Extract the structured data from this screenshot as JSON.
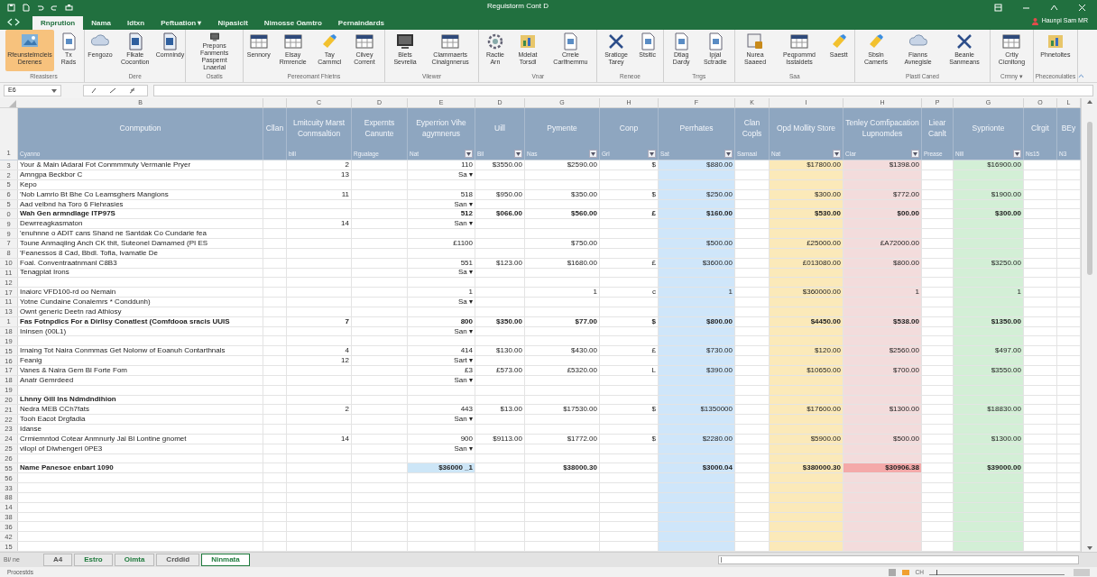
{
  "window": {
    "title": "Reguistorm Cont D",
    "account": "Haunpi Sam MR"
  },
  "ribbon_tabs": [
    {
      "label": "Rnprution",
      "selected": true
    },
    {
      "label": "Nama",
      "selected": false
    },
    {
      "label": "Idtxn",
      "selected": false
    },
    {
      "label": "Peftuation ▾",
      "selected": false
    },
    {
      "label": "Nipasiclt",
      "selected": false
    },
    {
      "label": "Nimosse Oamtro",
      "selected": false
    },
    {
      "label": "Pernaindards",
      "selected": false
    }
  ],
  "ribbon_groups": [
    {
      "label": "Rleasisers",
      "buttons": [
        {
          "label": "Rfeunstelmcleis Derenes",
          "selected": true
        },
        {
          "label": "Tx Rads",
          "selected": false
        }
      ]
    },
    {
      "label": "Dere",
      "buttons": [
        {
          "label": "Fengozo",
          "selected": false
        },
        {
          "label": "Flkate Cocontion",
          "selected": false
        },
        {
          "label": "Comnindy",
          "selected": false
        }
      ]
    },
    {
      "label": "Osatis",
      "buttons": [
        {
          "label": "Prepons Fanments Paspernt Lnaerlal",
          "selected": false
        }
      ]
    },
    {
      "label": "Pereeomant Fhietns",
      "buttons": [
        {
          "label": "Sennory",
          "selected": false
        },
        {
          "label": "Elsay Rmrencle",
          "selected": false
        },
        {
          "label": "Tay Carnmcl",
          "selected": false
        },
        {
          "label": "Cilvey Corrent",
          "selected": false
        }
      ]
    },
    {
      "label": "Vilewer",
      "buttons": [
        {
          "label": "Blets Sevrelia",
          "selected": false
        },
        {
          "label": "Clammaerts Cinalgnnerus",
          "selected": false
        }
      ]
    },
    {
      "label": "Vnar",
      "buttons": [
        {
          "label": "Ractie Arn",
          "selected": false
        },
        {
          "label": "Mdelat Torsdl",
          "selected": false
        },
        {
          "label": "Crrele Carlfnemmu",
          "selected": false
        }
      ]
    },
    {
      "label": "Reneoe",
      "buttons": [
        {
          "label": "Sraticge Tarey",
          "selected": false
        },
        {
          "label": "Stsitic",
          "selected": false
        }
      ]
    },
    {
      "label": "Trrgs",
      "buttons": [
        {
          "label": "Dtiag Dardy",
          "selected": false
        },
        {
          "label": "Ipjal Sctradle",
          "selected": false
        }
      ]
    },
    {
      "label": "Saa",
      "buttons": [
        {
          "label": "Nurea Saaeed",
          "selected": false
        },
        {
          "label": "Peqpommd Isstaldets",
          "selected": false
        },
        {
          "label": "Saestt",
          "selected": false
        }
      ]
    },
    {
      "label": "Plastl Caned",
      "buttons": [
        {
          "label": "Sbsln Camerls",
          "selected": false
        },
        {
          "label": "Fianns Avnegisle",
          "selected": false
        },
        {
          "label": "Beanle Sanmeans",
          "selected": false
        }
      ]
    },
    {
      "label": "Crmny ▾",
      "buttons": [
        {
          "label": "Crtiy Cicnltong",
          "selected": false
        }
      ]
    },
    {
      "label": "Pheceonulaties",
      "buttons": [
        {
          "label": "Phnetoltes",
          "selected": false
        }
      ]
    }
  ],
  "formula_bar": {
    "name_box": "E6"
  },
  "sheet": {
    "columns": [
      {
        "letter": "B",
        "title": "Conmpution",
        "subtitle": "Cyanno",
        "filter": false
      },
      {
        "title": "Cllan",
        "filter": false
      },
      {
        "letter": "C",
        "title": "Lmitcuity Marst Conmsaltion",
        "subtitle": "bill",
        "filter": false
      },
      {
        "letter": "D",
        "title": "Expernts Canunte",
        "subtitle": "Rgualage",
        "filter": false
      },
      {
        "letter": "E",
        "title": "Eyperrion Vihe agymnerus",
        "subtitle": "Nat",
        "filter": true
      },
      {
        "letter": "D",
        "title": "Uill",
        "subtitle": "Bil",
        "filter": true
      },
      {
        "letter": "G",
        "title": "Pymente",
        "subtitle": "Nas",
        "filter": true
      },
      {
        "letter": "H",
        "title": "Conp",
        "subtitle": "Grl",
        "filter": true
      },
      {
        "letter": "F",
        "title": "Perrhates",
        "subtitle": "Sat",
        "filter": true,
        "color": "#cfe6fa"
      },
      {
        "letter": "K",
        "title": "Clan Copls",
        "subtitle": "Samaal",
        "filter": false
      },
      {
        "letter": "I",
        "title": "Opd Mollity Store",
        "subtitle": "Nat",
        "filter": true,
        "color": "#fbe9b9"
      },
      {
        "letter": "H",
        "title": "Tenley Comfipacation Lupnomdes",
        "subtitle": "Clar",
        "filter": true,
        "color": "#f3dcdc"
      },
      {
        "letter": "P",
        "title": "Liear Canlt",
        "subtitle": "Prease",
        "filter": false
      },
      {
        "letter": "G",
        "title": "Syprionte",
        "subtitle": "Nill",
        "filter": true,
        "color": "#d3efd6"
      },
      {
        "letter": "O",
        "title": "Clrgit",
        "subtitle": "Ns15",
        "filter": false
      },
      {
        "letter": "L",
        "title": "BEy",
        "subtitle": "N3",
        "filter": false
      }
    ],
    "header_row_number": "1",
    "rows": [
      {
        "num": "3",
        "kind": "item",
        "cells": [
          "Your & Main lAdaral Fot Conmmmuty Vermanle Pryer",
          null,
          "2",
          null,
          "110",
          "$3550.00",
          "$2590.00",
          "$",
          "$880.00",
          null,
          "$17800.00",
          "$1398.00",
          null,
          "$16900.00",
          null,
          null
        ]
      },
      {
        "num": "2",
        "kind": "item",
        "cells": [
          "Amngpa Beckbor C",
          null,
          "13",
          null,
          "Sa ▾",
          null,
          null,
          null,
          null,
          null,
          null,
          null,
          null,
          null,
          null,
          null
        ]
      },
      {
        "num": "5",
        "kind": "item",
        "cells": [
          "Kepo",
          null,
          null,
          null,
          null,
          null,
          null,
          null,
          null,
          null,
          null,
          null,
          null,
          null,
          null,
          null
        ]
      },
      {
        "num": "6",
        "kind": "item",
        "cells": [
          "'Nob Lamrio Bt Bhe Co Leamsghers Mangions",
          null,
          "11",
          null,
          "518",
          "$950.00",
          "$350.00",
          "$",
          "$250.00",
          null,
          "$300.00",
          "$772.00",
          null,
          "$1900.00",
          null,
          null
        ]
      },
      {
        "num": "5",
        "kind": "item",
        "cells": [
          "Aad velbnd ha Toro 6 Fiehrasies",
          null,
          null,
          null,
          "San ▾",
          null,
          null,
          null,
          null,
          null,
          null,
          null,
          null,
          null,
          null,
          null
        ]
      },
      {
        "num": "0",
        "kind": "group",
        "cells": [
          "Wah Gen armndlage ITP97S",
          null,
          null,
          null,
          "512",
          "$066.00",
          "$560.00",
          "£",
          "$160.00",
          null,
          "$530.00",
          "$00.00",
          null,
          "$300.00",
          null,
          null
        ]
      },
      {
        "num": "9",
        "kind": "item",
        "cells": [
          "Dewrreagkasmaton",
          null,
          "14",
          null,
          "San ▾",
          null,
          null,
          null,
          null,
          null,
          null,
          null,
          null,
          null,
          null,
          null
        ]
      },
      {
        "num": "9",
        "kind": "item",
        "cells": [
          "'enuhnne o ADIT cans Shand ne Santdak Co Cundarie fea",
          null,
          null,
          null,
          null,
          null,
          null,
          null,
          null,
          null,
          null,
          null,
          null,
          null,
          null,
          null
        ]
      },
      {
        "num": "7",
        "kind": "item",
        "cells": [
          "Toune Anmaqiing Anch CK thit, Suteonel Damamed (PI ES",
          null,
          null,
          null,
          "£1100",
          null,
          "$750.00",
          null,
          "$500.00",
          null,
          "£25000.00",
          "£A72000.00",
          null,
          null,
          null,
          null
        ]
      },
      {
        "num": "8",
        "kind": "item",
        "cells": [
          "'Feanessos 8 Cad, Bbdl. Tofia, Ivamatle De",
          null,
          null,
          null,
          null,
          null,
          null,
          null,
          null,
          null,
          null,
          null,
          null,
          null,
          null,
          null
        ]
      },
      {
        "num": "10",
        "kind": "item",
        "cells": [
          "Foal. Conventraatnmanl C8B3",
          null,
          null,
          null,
          "551",
          "$123.00",
          "$1680.00",
          "£",
          "$3600.00",
          null,
          "£013080.00",
          "$800.00",
          null,
          "$3250.00",
          null,
          null
        ]
      },
      {
        "num": "11",
        "kind": "item",
        "cells": [
          "Tenagplat Irons",
          null,
          null,
          null,
          "Sa ▾",
          null,
          null,
          null,
          null,
          null,
          null,
          null,
          null,
          null,
          null,
          null
        ]
      },
      {
        "num": "12",
        "kind": "item",
        "cells": [
          null,
          null,
          null,
          null,
          null,
          null,
          null,
          null,
          null,
          null,
          null,
          null,
          null,
          null,
          null,
          null
        ]
      },
      {
        "num": "17",
        "kind": "item",
        "cells": [
          "Inaiorc VFD100-rd oo Nemain",
          null,
          null,
          null,
          "1",
          null,
          "1",
          "c",
          "1",
          null,
          "$360000.00",
          "1",
          null,
          "1",
          null,
          null
        ]
      },
      {
        "num": "11",
        "kind": "item",
        "cells": [
          "Yotne Cundaine Conalemrs * Conddunh)",
          null,
          null,
          null,
          "Sa ▾",
          null,
          null,
          null,
          null,
          null,
          null,
          null,
          null,
          null,
          null,
          null
        ]
      },
      {
        "num": "13",
        "kind": "item",
        "cells": [
          "Ownt generic Deetn rad Athiosy",
          null,
          null,
          null,
          null,
          null,
          null,
          null,
          null,
          null,
          null,
          null,
          null,
          null,
          null,
          null
        ]
      },
      {
        "num": "1",
        "kind": "group",
        "cells": [
          "Fas Fotnpdics For a Dirlisy Conatlest (Comfdooa sracis UUIS",
          null,
          "7",
          null,
          "800",
          "$350.00",
          "$77.00",
          "$",
          "$800.00",
          null,
          "$4450.00",
          "$538.00",
          null,
          "$1350.00",
          null,
          null
        ]
      },
      {
        "num": "18",
        "kind": "item",
        "cells": [
          "Ininsen (00L1)",
          null,
          null,
          null,
          "San ▾",
          null,
          null,
          null,
          null,
          null,
          null,
          null,
          null,
          null,
          null,
          null
        ]
      },
      {
        "num": "19",
        "kind": "item",
        "cells": [
          null,
          null,
          null,
          null,
          null,
          null,
          null,
          null,
          null,
          null,
          null,
          null,
          null,
          null,
          null,
          null
        ]
      },
      {
        "num": "15",
        "kind": "item",
        "cells": [
          "Irnaing Tot Naira Conmmas Get Nolonw of Eoanuh Contarthnals",
          null,
          "4",
          null,
          "414",
          "$130.00",
          "$430.00",
          "£",
          "$730.00",
          null,
          "$120.00",
          "$2560.00",
          null,
          "$497.00",
          null,
          null
        ]
      },
      {
        "num": "16",
        "kind": "item",
        "cells": [
          "Feanig",
          null,
          "12",
          null,
          "Sart ▾",
          null,
          null,
          null,
          null,
          null,
          null,
          null,
          null,
          null,
          null,
          null
        ]
      },
      {
        "num": "17",
        "kind": "item",
        "cells": [
          "Vanes & Naira Gem Bl Forte Fom",
          null,
          null,
          null,
          "£3",
          "£573.00",
          "£5320.00",
          "L",
          "$390.00",
          null,
          "$10650.00",
          "$700.00",
          null,
          "$3550.00",
          null,
          null
        ]
      },
      {
        "num": "18",
        "kind": "item",
        "cells": [
          "Anatr Gemrdeed",
          null,
          null,
          null,
          "San ▾",
          null,
          null,
          null,
          null,
          null,
          null,
          null,
          null,
          null,
          null,
          null
        ]
      },
      {
        "num": "19",
        "kind": "item",
        "cells": [
          null,
          null,
          null,
          null,
          null,
          null,
          null,
          null,
          null,
          null,
          null,
          null,
          null,
          null,
          null,
          null
        ]
      },
      {
        "num": "20",
        "kind": "group",
        "cells": [
          "Lhnny Gill Ins Ndmdndihion",
          null,
          null,
          null,
          null,
          null,
          null,
          null,
          null,
          null,
          null,
          null,
          null,
          null,
          null,
          null
        ]
      },
      {
        "num": "21",
        "kind": "item",
        "cells": [
          "Nedra MEB CCh7fats",
          null,
          "2",
          null,
          "443",
          "$13.00",
          "$17530.00",
          "$",
          "$1350000",
          null,
          "$17600.00",
          "$1300.00",
          null,
          "$18830.00",
          null,
          null
        ]
      },
      {
        "num": "22",
        "kind": "item",
        "cells": [
          "Tooh Eacot Drgfadia",
          null,
          null,
          null,
          "San ▾",
          null,
          null,
          null,
          null,
          null,
          null,
          null,
          null,
          null,
          null,
          null
        ]
      },
      {
        "num": "23",
        "kind": "item",
        "cells": [
          "Idanse",
          null,
          null,
          null,
          null,
          null,
          null,
          null,
          null,
          null,
          null,
          null,
          null,
          null,
          null,
          null
        ]
      },
      {
        "num": "24",
        "kind": "item",
        "cells": [
          "Crmiemntod Cotear Anmnurly Jal Bl Lontine gnomet",
          null,
          "14",
          null,
          "900",
          "$9113.00",
          "$1772.00",
          "$",
          "$2280.00",
          null,
          "$5900.00",
          "$500.00",
          null,
          "$1300.00",
          null,
          null
        ]
      },
      {
        "num": "25",
        "kind": "item",
        "cells": [
          "vilopl of Dlwhengeri 0PE3",
          null,
          null,
          null,
          "San ▾",
          null,
          null,
          null,
          null,
          null,
          null,
          null,
          null,
          null,
          null,
          null
        ]
      },
      {
        "num": "26",
        "kind": "item",
        "cells": [
          null,
          null,
          null,
          null,
          null,
          null,
          null,
          null,
          null,
          null,
          null,
          null,
          null,
          null,
          null,
          null
        ]
      },
      {
        "num": "55",
        "kind": "total",
        "cells": [
          "Name Panesoe enbart 1090",
          null,
          null,
          null,
          {
            "text": "$36000 _1",
            "color": "#cde6f7"
          },
          null,
          "$38000.30",
          null,
          "$3000.04",
          null,
          "$380000.30",
          {
            "text": "$30906.38",
            "color": "#f4a9a9"
          },
          null,
          "$39000.00",
          null,
          null
        ]
      },
      {
        "num": "56",
        "kind": "item",
        "cells": [
          null,
          null,
          null,
          null,
          null,
          null,
          null,
          null,
          null,
          null,
          null,
          null,
          null,
          null,
          null,
          null
        ]
      },
      {
        "num": "33",
        "kind": "item",
        "cells": [
          null,
          null,
          null,
          null,
          null,
          null,
          null,
          null,
          null,
          null,
          null,
          null,
          null,
          null,
          null,
          null
        ]
      },
      {
        "num": "88",
        "kind": "item",
        "cells": [
          null,
          null,
          null,
          null,
          null,
          null,
          null,
          null,
          null,
          null,
          null,
          null,
          null,
          null,
          null,
          null
        ]
      },
      {
        "num": "14",
        "kind": "item",
        "cells": [
          null,
          null,
          null,
          null,
          null,
          null,
          null,
          null,
          null,
          null,
          null,
          null,
          null,
          null,
          null,
          null
        ]
      },
      {
        "num": "38",
        "kind": "item",
        "cells": [
          null,
          null,
          null,
          null,
          null,
          null,
          null,
          null,
          null,
          null,
          null,
          null,
          null,
          null,
          null,
          null
        ]
      },
      {
        "num": "36",
        "kind": "item",
        "cells": [
          null,
          null,
          null,
          null,
          null,
          null,
          null,
          null,
          null,
          null,
          null,
          null,
          null,
          null,
          null,
          null
        ]
      },
      {
        "num": "42",
        "kind": "item",
        "cells": [
          null,
          null,
          null,
          null,
          null,
          null,
          null,
          null,
          null,
          null,
          null,
          null,
          null,
          null,
          null,
          null
        ]
      },
      {
        "num": "15",
        "kind": "item",
        "cells": [
          null,
          null,
          null,
          null,
          null,
          null,
          null,
          null,
          null,
          null,
          null,
          null,
          null,
          null,
          null,
          null
        ]
      }
    ]
  },
  "sheet_tabs": [
    {
      "label": "A4",
      "selected": false,
      "color": "#555555"
    },
    {
      "label": "Estro",
      "selected": false,
      "color": "#1e7a3c"
    },
    {
      "label": "Oimta",
      "selected": false,
      "color": "#1e7a3c"
    },
    {
      "label": "Crddid",
      "selected": false,
      "color": "#555555"
    },
    {
      "label": "Ninmata",
      "selected": true,
      "color": "#1e7a3c"
    }
  ],
  "status_bar": {
    "left": "Procestds",
    "sheet_nav": "Bi/ ne",
    "indicator": "CH",
    "zoom": {
      "level": 0.05
    }
  }
}
